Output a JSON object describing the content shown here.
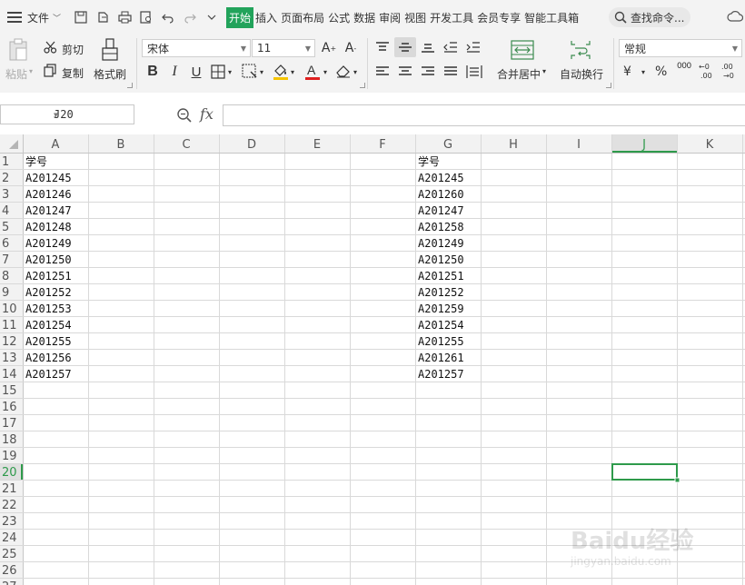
{
  "menubar": {
    "file_label": "文件",
    "tabs": [
      {
        "label": "开始",
        "active": true
      },
      {
        "label": "插入",
        "active": false
      },
      {
        "label": "页面布局",
        "active": false
      },
      {
        "label": "公式",
        "active": false
      },
      {
        "label": "数据",
        "active": false
      },
      {
        "label": "审阅",
        "active": false
      },
      {
        "label": "视图",
        "active": false
      },
      {
        "label": "开发工具",
        "active": false
      },
      {
        "label": "会员专享",
        "active": false
      },
      {
        "label": "智能工具箱",
        "active": false
      }
    ],
    "search_placeholder": "查找命令..."
  },
  "ribbon": {
    "paste_label": "粘贴",
    "cut_label": "剪切",
    "copy_label": "复制",
    "format_painter_label": "格式刷",
    "font_name": "宋体",
    "font_size": "11",
    "merge_label": "合并居中",
    "wrap_label": "自动换行",
    "number_format": "常规",
    "currency_symbol": "¥",
    "percent_symbol": "%",
    "thousands_symbol": "000"
  },
  "formula_bar": {
    "name_box": "J20",
    "fx_label": "fx",
    "formula": ""
  },
  "sheet": {
    "columns": [
      "A",
      "B",
      "C",
      "D",
      "E",
      "F",
      "G",
      "H",
      "I",
      "J",
      "K"
    ],
    "row_count": 27,
    "selected_cell": "J20",
    "column_a": [
      "学号",
      "A201245",
      "A201246",
      "A201247",
      "A201248",
      "A201249",
      "A201250",
      "A201251",
      "A201252",
      "A201253",
      "A201254",
      "A201255",
      "A201256",
      "A201257"
    ],
    "column_g": [
      "学号",
      "A201245",
      "A201260",
      "A201247",
      "A201258",
      "A201249",
      "A201250",
      "A201251",
      "A201252",
      "A201259",
      "A201254",
      "A201255",
      "A201261",
      "A201257"
    ]
  },
  "colors": {
    "accent": "#22a35b",
    "selection_border": "#2e9a4b",
    "header_bg": "#f2f2f2",
    "gridline": "#d9d9d9"
  },
  "watermark": {
    "brand": "Baidu经验",
    "url": "jingyan.baidu.com"
  }
}
